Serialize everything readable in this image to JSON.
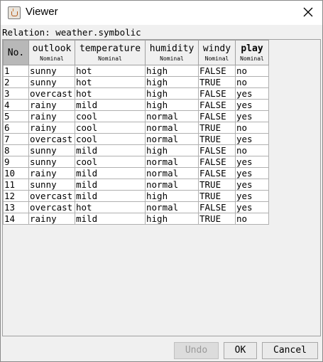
{
  "window": {
    "title": "Viewer",
    "app_icon": "java-icon"
  },
  "relation_label": "Relation: weather.symbolic",
  "table": {
    "columns": [
      {
        "name": "No.",
        "type": ""
      },
      {
        "name": "outlook",
        "type": "Nominal"
      },
      {
        "name": "temperature",
        "type": "Nominal"
      },
      {
        "name": "humidity",
        "type": "Nominal"
      },
      {
        "name": "windy",
        "type": "Nominal"
      },
      {
        "name": "play",
        "type": "Nominal"
      }
    ],
    "rows": [
      [
        "1",
        "sunny",
        "hot",
        "high",
        "FALSE",
        "no"
      ],
      [
        "2",
        "sunny",
        "hot",
        "high",
        "TRUE",
        "no"
      ],
      [
        "3",
        "overcast",
        "hot",
        "high",
        "FALSE",
        "yes"
      ],
      [
        "4",
        "rainy",
        "mild",
        "high",
        "FALSE",
        "yes"
      ],
      [
        "5",
        "rainy",
        "cool",
        "normal",
        "FALSE",
        "yes"
      ],
      [
        "6",
        "rainy",
        "cool",
        "normal",
        "TRUE",
        "no"
      ],
      [
        "7",
        "overcast",
        "cool",
        "normal",
        "TRUE",
        "yes"
      ],
      [
        "8",
        "sunny",
        "mild",
        "high",
        "FALSE",
        "no"
      ],
      [
        "9",
        "sunny",
        "cool",
        "normal",
        "FALSE",
        "yes"
      ],
      [
        "10",
        "rainy",
        "mild",
        "normal",
        "FALSE",
        "yes"
      ],
      [
        "11",
        "sunny",
        "mild",
        "normal",
        "TRUE",
        "yes"
      ],
      [
        "12",
        "overcast",
        "mild",
        "high",
        "TRUE",
        "yes"
      ],
      [
        "13",
        "overcast",
        "hot",
        "normal",
        "FALSE",
        "yes"
      ],
      [
        "14",
        "rainy",
        "mild",
        "high",
        "TRUE",
        "no"
      ]
    ]
  },
  "buttons": {
    "undo": "Undo",
    "ok": "OK",
    "cancel": "Cancel"
  }
}
